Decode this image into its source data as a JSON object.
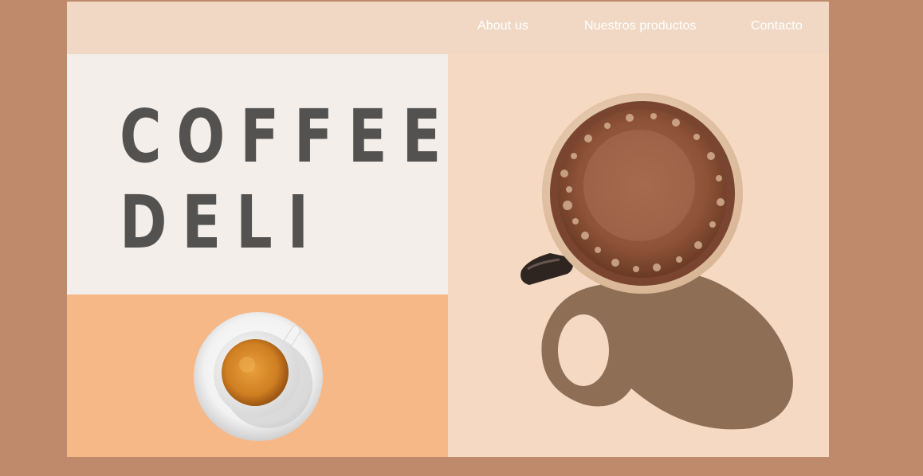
{
  "nav": {
    "links": [
      "About us",
      "Nuestros productos",
      "Contacto"
    ]
  },
  "hero": {
    "title_line1": "COFFEE",
    "title_line2": "DELI"
  },
  "images": {
    "small_cup": "espresso cup on saucer, top view",
    "photo": "mug of coffee with shadow, top view"
  },
  "colors": {
    "outer_background": "#bf8a6c",
    "nav_background": "#f1d8c4",
    "title_panel": "#f3eee9",
    "title_text": "#545250",
    "cup_panel": "#f7b888",
    "photo_background": "#f5d9c2"
  }
}
